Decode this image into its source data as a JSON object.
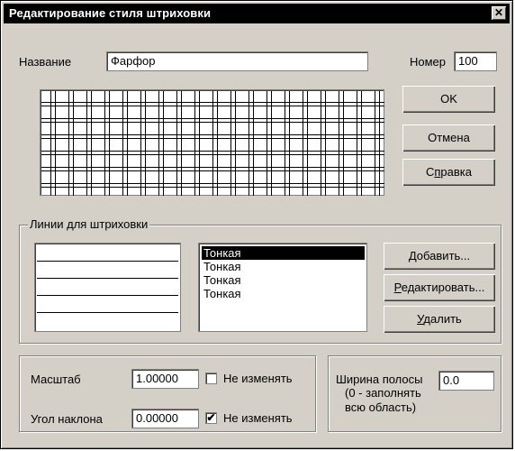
{
  "window": {
    "title": "Редактирование стиля штриховки",
    "close_label": "✕"
  },
  "name": {
    "label": "Название",
    "value": "Фарфор"
  },
  "number": {
    "label": "Номер",
    "value": "100"
  },
  "buttons": {
    "ok": "OK",
    "cancel": "Отмена",
    "help": "Справка"
  },
  "lines_group": {
    "title": "Линии для штриховки",
    "items": [
      "Тонкая",
      "Тонкая",
      "Тонкая",
      "Тонкая"
    ],
    "selected_index": 0,
    "add": "Добавить...",
    "edit": "Редактировать...",
    "delete": "Удалить"
  },
  "scale": {
    "label": "Масштаб",
    "value": "1.00000",
    "checkbox_label": "Не изменять",
    "checked": false
  },
  "angle": {
    "label": "Угол наклона",
    "value": "0.00000",
    "checkbox_label": "Не изменять",
    "checked": true
  },
  "band": {
    "label_line1": "Ширина полосы",
    "label_line2": "(0 - заполнять",
    "label_line3": "всю область)",
    "value": "0.0"
  }
}
